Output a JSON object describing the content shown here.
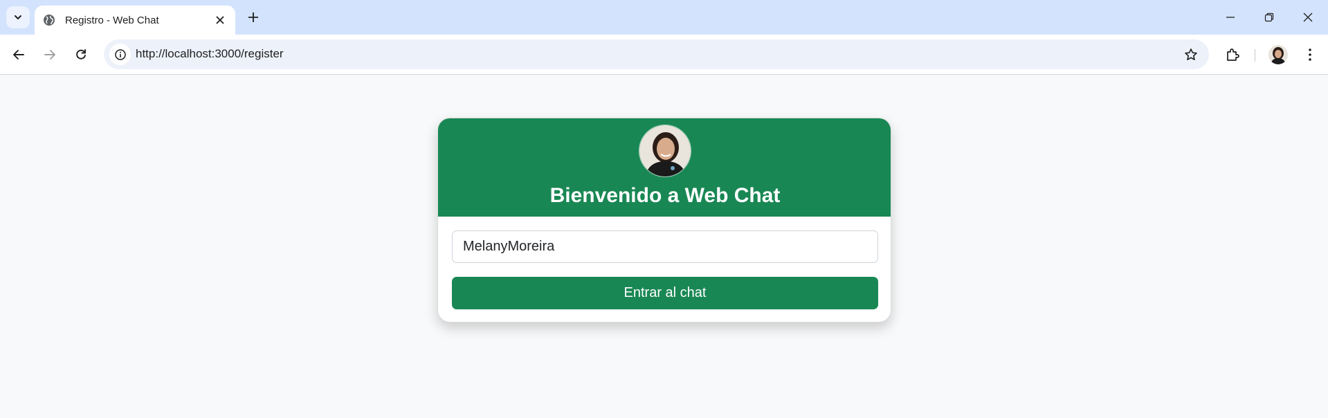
{
  "browser": {
    "tab": {
      "title": "Registro - Web Chat"
    },
    "address_bar": {
      "url": "http://localhost:3000/register"
    }
  },
  "page": {
    "heading": "Bienvenido a Web Chat",
    "username_input": {
      "value": "MelanyMoreira"
    },
    "submit_button": {
      "label": "Entrar al chat"
    }
  },
  "colors": {
    "brand_green": "#198754",
    "tabstrip": "#d3e3fd",
    "page_background": "#f8f9fa"
  },
  "icons": [
    "tab-search-icon",
    "globe-icon",
    "close-icon",
    "plus-icon",
    "minimize-icon",
    "restore-icon",
    "window-close-icon",
    "back-arrow-icon",
    "forward-arrow-icon",
    "reload-icon",
    "info-icon",
    "star-icon",
    "extensions-icon",
    "kebab-menu-icon"
  ]
}
